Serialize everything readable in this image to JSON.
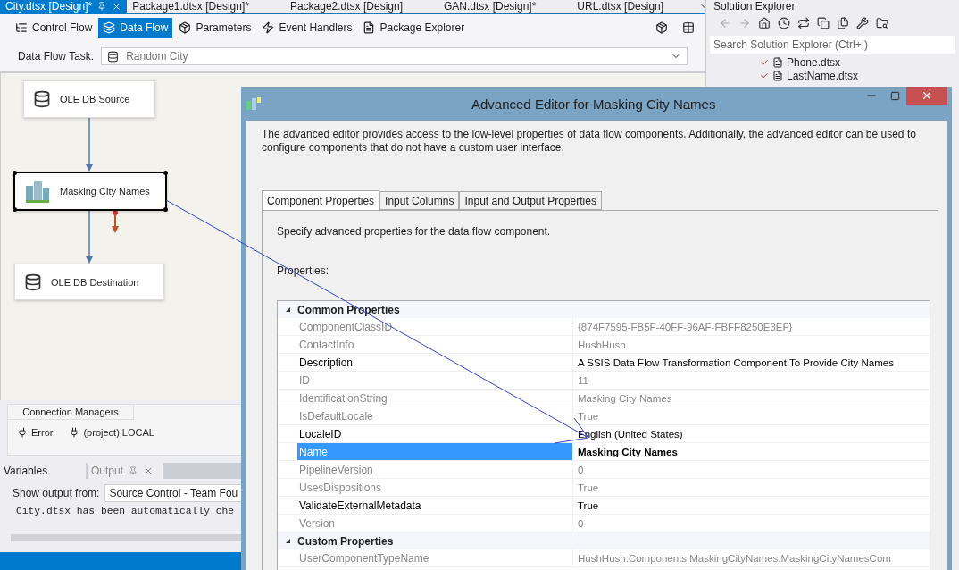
{
  "document_tabs": [
    {
      "label": "City.dtsx [Design]*",
      "selected": true
    },
    {
      "label": "Package1.dtsx [Design]*",
      "selected": false
    },
    {
      "label": "Package2.dtsx [Design]",
      "selected": false
    },
    {
      "label": "GAN.dtsx [Design]*",
      "selected": false
    },
    {
      "label": "URL.dtsx [Design]",
      "selected": false
    }
  ],
  "designer_tabs": [
    {
      "label": "Control Flow",
      "selected": false
    },
    {
      "label": "Data Flow",
      "selected": true
    },
    {
      "label": "Parameters",
      "selected": false
    },
    {
      "label": "Event Handlers",
      "selected": false
    },
    {
      "label": "Package Explorer",
      "selected": false
    }
  ],
  "task": {
    "label": "Data Flow Task:",
    "value": "Random City"
  },
  "canvas": {
    "nodes": [
      {
        "label": "OLE DB Source",
        "kind": "source",
        "selected": false
      },
      {
        "label": "Masking City Names",
        "kind": "transform",
        "selected": true
      },
      {
        "label": "OLE DB Destination",
        "kind": "destination",
        "selected": false
      }
    ]
  },
  "connection_managers": {
    "title": "Connection Managers",
    "items": [
      {
        "label": "Error"
      },
      {
        "label": "(project) LOCAL"
      }
    ]
  },
  "output_panel": {
    "tabs": [
      {
        "label": "Variables",
        "selected": false
      },
      {
        "label": "Output",
        "selected": true
      }
    ],
    "show_label": "Show output from:",
    "source": "Source Control - Team Fou",
    "lines": [
      "City.dtsx has been automatically che"
    ]
  },
  "solution_explorer": {
    "title": "Solution Explorer",
    "search_placeholder": "Search Solution Explorer (Ctrl+;)",
    "items": [
      {
        "label": "Phone.dtsx"
      },
      {
        "label": "LastName.dtsx"
      }
    ]
  },
  "dialog": {
    "title": "Advanced Editor for Masking City Names",
    "description": "The advanced editor provides access to the low-level properties of data flow components. Additionally, the advanced editor can be used to configure components that do not have a custom user interface.",
    "tabs": [
      {
        "label": "Component Properties",
        "selected": true
      },
      {
        "label": "Input Columns",
        "selected": false
      },
      {
        "label": "Input and Output Properties",
        "selected": false
      }
    ],
    "instruction": "Specify advanced properties for the data flow component.",
    "properties_label": "Properties:",
    "categories": [
      {
        "name": "Common Properties",
        "expanded": true,
        "rows": [
          {
            "name": "ComponentClassID",
            "value": "{874F7595-FB5F-40FF-96AF-FBFF8250E3EF}",
            "readonly": true,
            "selected": false,
            "modified": false
          },
          {
            "name": "ContactInfo",
            "value": "HushHush",
            "readonly": true,
            "selected": false,
            "modified": false
          },
          {
            "name": "Description",
            "value": "A SSIS Data Flow Transformation Component To Provide City Names",
            "readonly": false,
            "selected": false,
            "modified": false
          },
          {
            "name": "ID",
            "value": "11",
            "readonly": true,
            "selected": false,
            "modified": false
          },
          {
            "name": "IdentificationString",
            "value": "Masking City Names",
            "readonly": true,
            "selected": false,
            "modified": false
          },
          {
            "name": "IsDefaultLocale",
            "value": "True",
            "readonly": true,
            "selected": false,
            "modified": false
          },
          {
            "name": "LocaleID",
            "value": "English (United States)",
            "readonly": false,
            "selected": false,
            "modified": false
          },
          {
            "name": "Name",
            "value": "Masking City Names",
            "readonly": false,
            "selected": true,
            "modified": true
          },
          {
            "name": "PipelineVersion",
            "value": "0",
            "readonly": true,
            "selected": false,
            "modified": false
          },
          {
            "name": "UsesDispositions",
            "value": "True",
            "readonly": true,
            "selected": false,
            "modified": false
          },
          {
            "name": "ValidateExternalMetadata",
            "value": "True",
            "readonly": false,
            "selected": false,
            "modified": false
          },
          {
            "name": "Version",
            "value": "0",
            "readonly": true,
            "selected": false,
            "modified": false
          }
        ]
      },
      {
        "name": "Custom Properties",
        "expanded": true,
        "rows": [
          {
            "name": "UserComponentTypeName",
            "value": "HushHush.Components.MaskingCityNames.MaskingCityNamesCom",
            "readonly": true,
            "selected": false,
            "modified": false
          }
        ]
      }
    ]
  }
}
